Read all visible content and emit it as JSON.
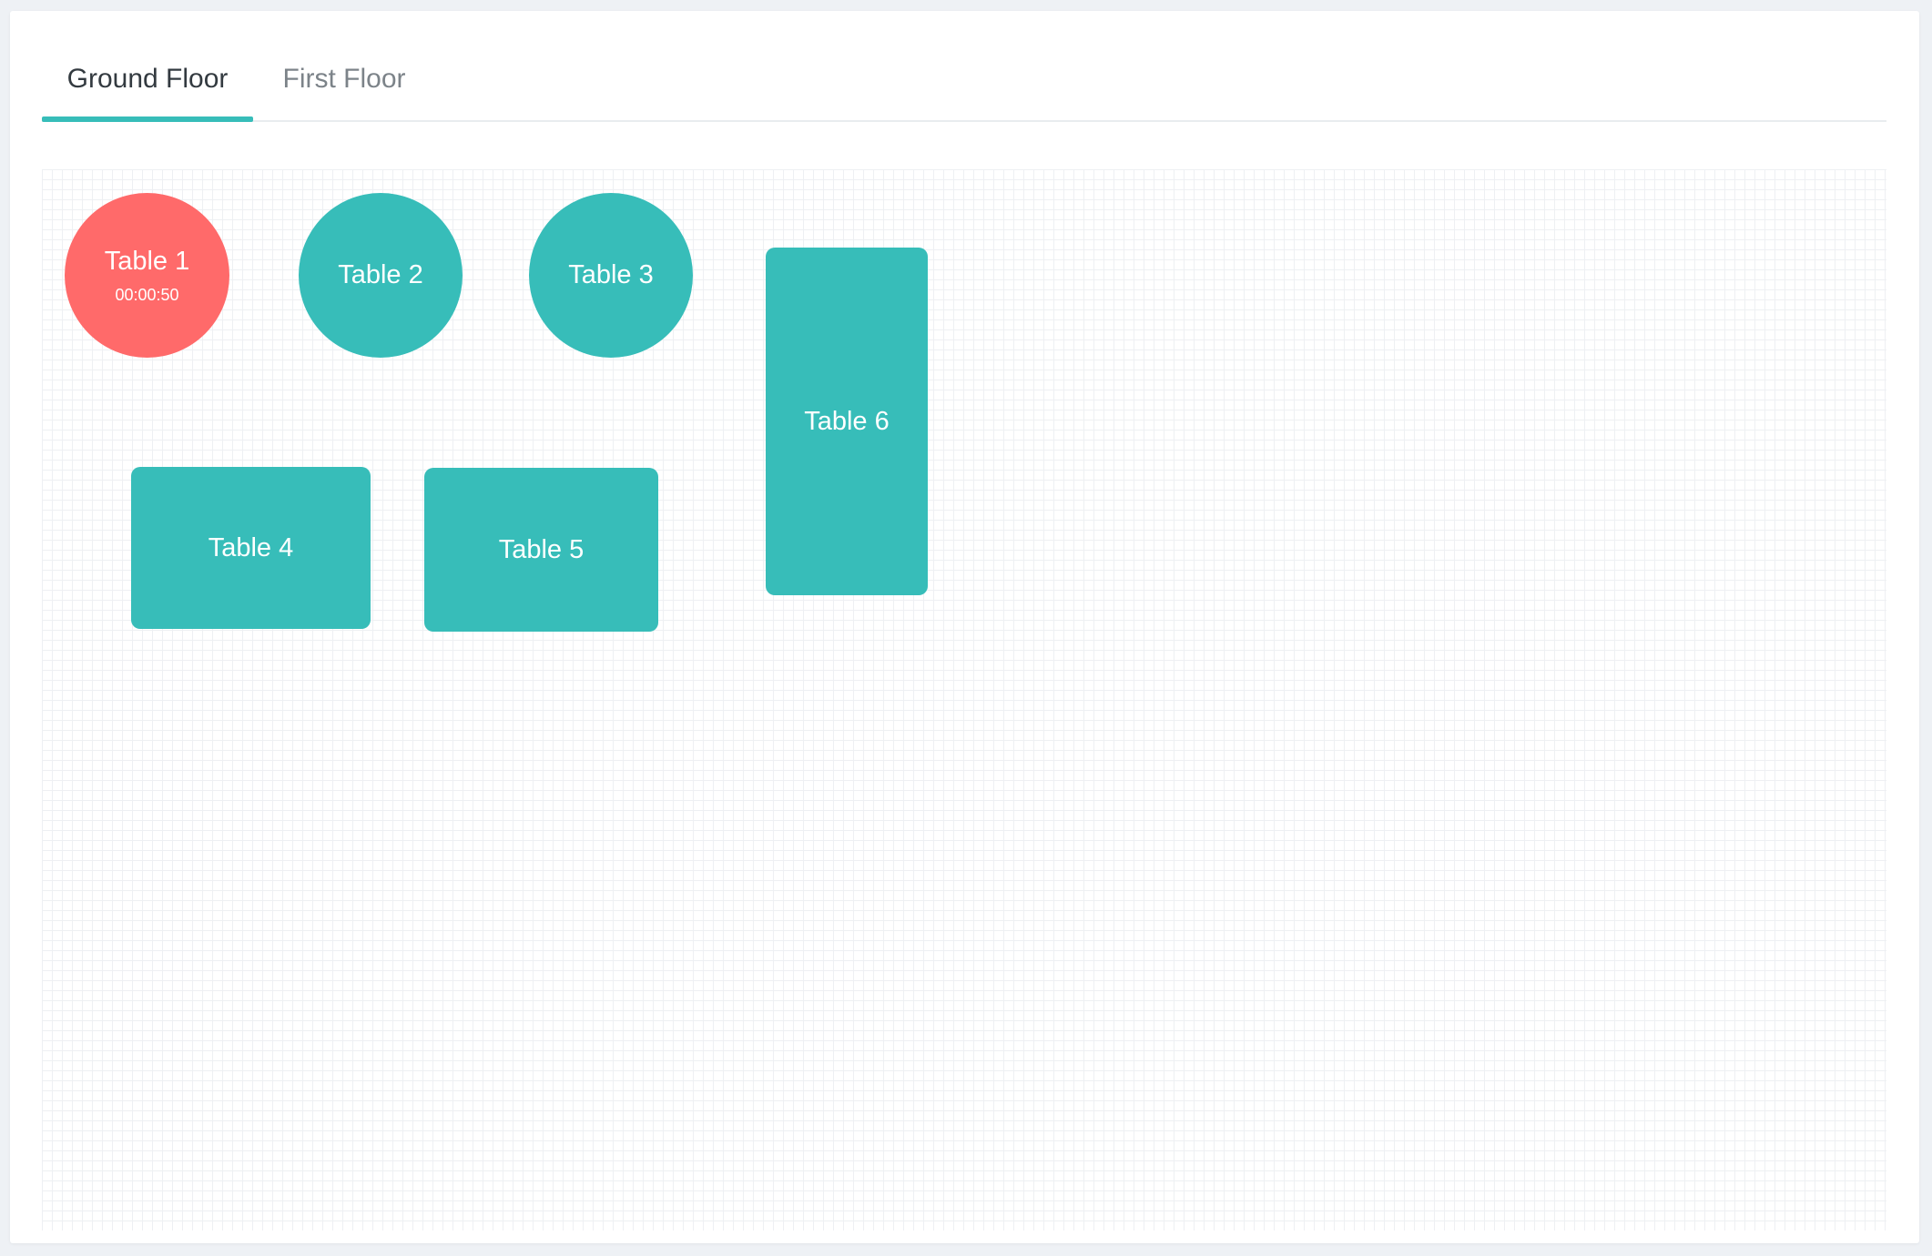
{
  "tabs": [
    {
      "label": "Ground Floor",
      "active": true
    },
    {
      "label": "First Floor",
      "active": false
    }
  ],
  "colors": {
    "accent": "#37bdb9",
    "occupied": "#ff6a6a",
    "free": "#37bdb9"
  },
  "tables": [
    {
      "name": "Table 1",
      "shape": "round",
      "status": "occupied",
      "timer": "00:00:50"
    },
    {
      "name": "Table 2",
      "shape": "round",
      "status": "free"
    },
    {
      "name": "Table 3",
      "shape": "round",
      "status": "free"
    },
    {
      "name": "Table 4",
      "shape": "rectangle",
      "status": "free"
    },
    {
      "name": "Table 5",
      "shape": "rectangle",
      "status": "free"
    },
    {
      "name": "Table 6",
      "shape": "rectangle",
      "status": "free"
    }
  ]
}
